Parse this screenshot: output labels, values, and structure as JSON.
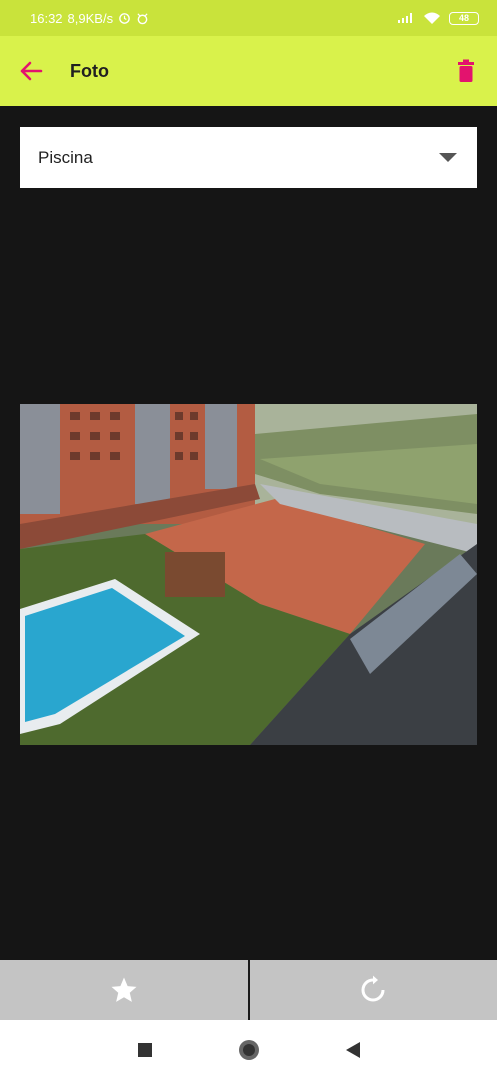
{
  "status_bar": {
    "time": "16:32",
    "speed": "8,9KB/s",
    "battery": "48"
  },
  "app_bar": {
    "title": "Foto",
    "back_icon": "arrow-left-icon",
    "delete_icon": "trash-icon"
  },
  "category_select": {
    "selected_value": "Piscina"
  },
  "photo": {
    "description_icon": "photo"
  },
  "bottom_actions": {
    "favorite_icon": "star-icon",
    "rotate_icon": "rotate-icon"
  },
  "colors": {
    "status_bar": "#c9e33b",
    "app_bar": "#d9f24b",
    "accent": "#e3136e"
  }
}
